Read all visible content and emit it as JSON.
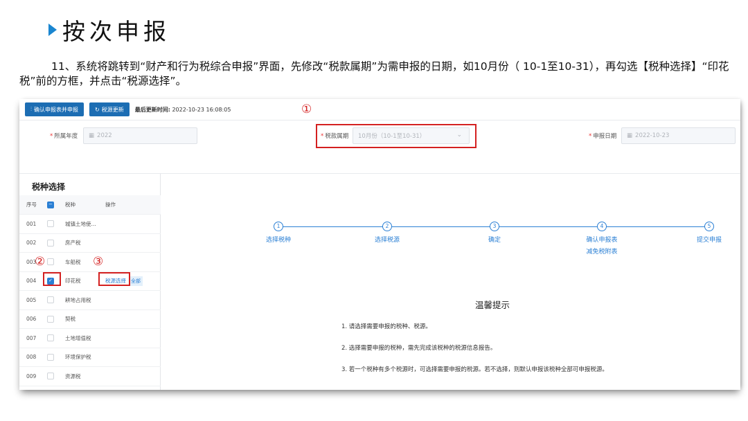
{
  "slide": {
    "title": "按次申报",
    "instruction": "11、系统将跳转到“财产和行为税综合申报”界面，先修改“税款属期”为需申报的日期，如10月份（ 10-1至10-31），再勾选【税种选择】“印花税”前的方框，并点击“税源选择”。"
  },
  "toolbar": {
    "confirm_label": "确认申报表并申报",
    "refresh_label": "税源更新",
    "last_update_label": "最后更新时间:",
    "last_update_value": "2022-10-23 16:08:05"
  },
  "annotations": {
    "a1": "①",
    "a2": "②",
    "a3": "③"
  },
  "form": {
    "year_label": "所属年度",
    "year_value": "2022",
    "period_label": "税款属期",
    "period_value": "10月份（10-1至10-31）",
    "date_label": "申报日期",
    "date_value": "2022-10-23"
  },
  "tax_panel": {
    "title": "税种选择",
    "headers": {
      "no": "序号",
      "name": "税种",
      "op": "操作"
    },
    "rows": [
      {
        "no": "001",
        "name": "城镇土地使...",
        "checked": false
      },
      {
        "no": "002",
        "name": "房产税",
        "checked": false
      },
      {
        "no": "003",
        "name": "车船税",
        "checked": false
      },
      {
        "no": "004",
        "name": "印花税",
        "checked": true,
        "op": "税源选择",
        "tag": "全部"
      },
      {
        "no": "005",
        "name": "耕地占用税",
        "checked": false
      },
      {
        "no": "006",
        "name": "契税",
        "checked": false
      },
      {
        "no": "007",
        "name": "土地增值税",
        "checked": false
      },
      {
        "no": "008",
        "name": "环境保护税",
        "checked": false
      },
      {
        "no": "009",
        "name": "资源税",
        "checked": false
      }
    ]
  },
  "steps": [
    {
      "num": "1",
      "label": "选择税种"
    },
    {
      "num": "2",
      "label": "选择税源"
    },
    {
      "num": "3",
      "label": "确定"
    },
    {
      "num": "4",
      "label": "确认申报表",
      "label2": "减免税附表"
    },
    {
      "num": "5",
      "label": "提交申报"
    }
  ],
  "tips": {
    "title": "温馨提示",
    "items": [
      "1. 请选择需要申报的税种、税源。",
      "2. 选择需要申报的税种，需先完成该税种的税源信息报告。",
      "3. 若一个税种有多个税源时，可选择需要申报的税源。若不选择，则默认申报该税种全部可申报税源。"
    ]
  },
  "colors": {
    "primary": "#1c6db3",
    "accent": "#2a7fd4",
    "annotation": "#d42020"
  }
}
